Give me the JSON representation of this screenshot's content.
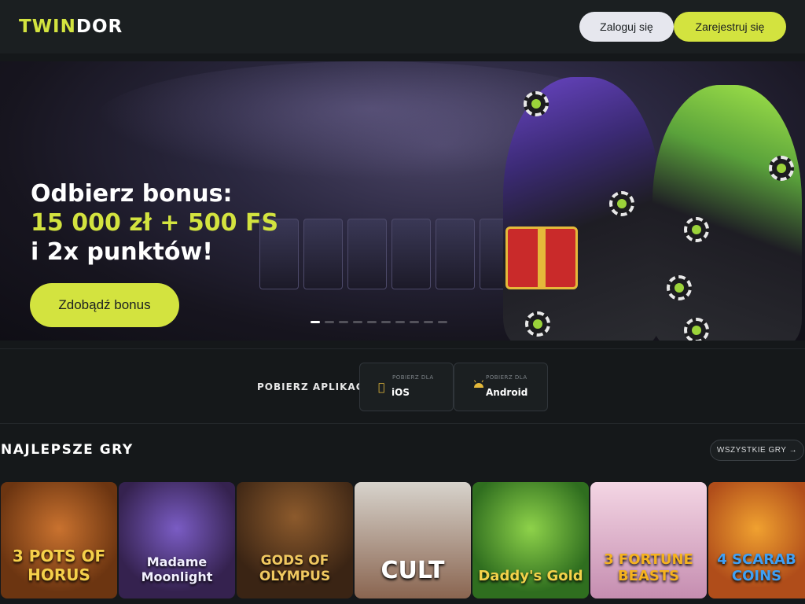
{
  "header": {
    "logo_part1": "TWIN",
    "logo_part2": "DOR",
    "login_label": "Zaloguj się",
    "register_label": "Zarejestruj się"
  },
  "hero": {
    "line1": "Odbierz bonus:",
    "line2": "15 000 zł + 500 FS",
    "line3": "i 2x punktów!",
    "cta_label": "Zdobądź bonus",
    "slide_count": 10,
    "active_slide": 1
  },
  "app": {
    "label": "POBIERZ APLIKACJĘ",
    "ios": {
      "small": "POBIERZ DLA",
      "name": "iOS",
      "icon": "apple-icon"
    },
    "android": {
      "small": "POBIERZ DLA",
      "name": "Android",
      "icon": "android-icon"
    }
  },
  "games_section": {
    "title": "NAJLEPSZE GRY",
    "all_label": "WSZYSTKIE GRY →",
    "games": [
      {
        "title": "3 POTS OF HORUS"
      },
      {
        "title": "Madame Moonlight"
      },
      {
        "title": "GODS OF OLYMPUS"
      },
      {
        "title": "CULT"
      },
      {
        "title": "Daddy's Gold"
      },
      {
        "title": "3 FORTUNE BEASTS"
      },
      {
        "title": "4 SCARAB COINS"
      }
    ]
  },
  "colors": {
    "accent": "#d3e33f",
    "background": "#15181a",
    "header": "#1b1f21"
  }
}
